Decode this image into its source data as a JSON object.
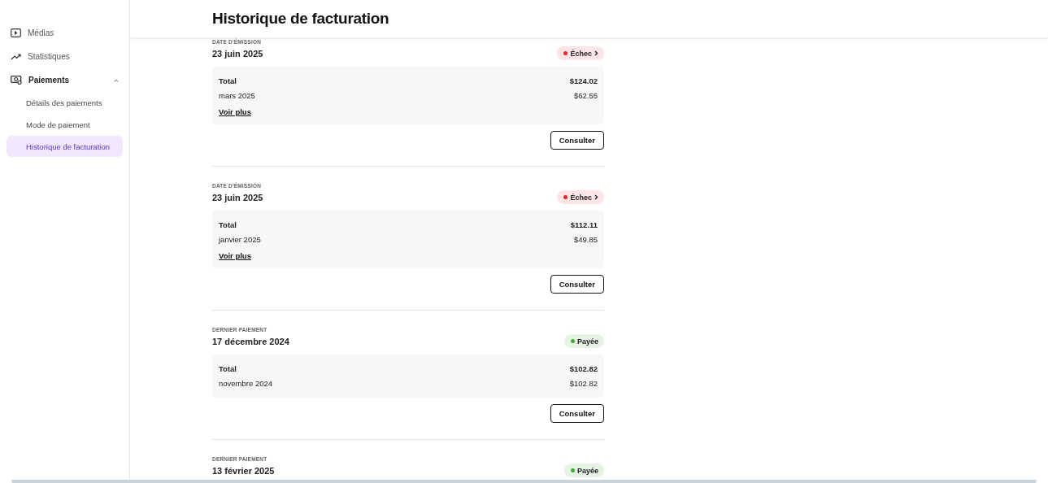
{
  "sidebar": {
    "items": [
      {
        "label": "Médias"
      },
      {
        "label": "Statistiques"
      },
      {
        "label": "Paiements",
        "expanded": true,
        "children": [
          {
            "label": "Détails des paiements",
            "selected": false
          },
          {
            "label": "Mode de paiement",
            "selected": false
          },
          {
            "label": "Historique de facturation",
            "selected": true
          }
        ]
      }
    ]
  },
  "page_title": "Historique de facturation",
  "invoices": [
    {
      "date_label": "DATE D'ÉMISSION",
      "date": "23 juin 2025",
      "status": {
        "label": "Échec",
        "kind": "failed"
      },
      "total_label": "Total",
      "total": "$124.02",
      "lines": [
        {
          "label": "mars 2025",
          "amount": "$62.55"
        }
      ],
      "more_link": "Voir plus",
      "button": "Consulter"
    },
    {
      "date_label": "DATE D'ÉMISSION",
      "date": "23 juin 2025",
      "status": {
        "label": "Échec",
        "kind": "failed"
      },
      "total_label": "Total",
      "total": "$112.11",
      "lines": [
        {
          "label": "janvier 2025",
          "amount": "$49.85"
        }
      ],
      "more_link": "Voir plus",
      "button": "Consulter"
    },
    {
      "date_label": "DERNIER PAIEMENT",
      "date": "17 décembre 2024",
      "status": {
        "label": "Payée",
        "kind": "paid"
      },
      "total_label": "Total",
      "total": "$102.82",
      "lines": [
        {
          "label": "novembre 2024",
          "amount": "$102.82"
        }
      ],
      "button": "Consulter"
    },
    {
      "date_label": "DERNIER PAIEMENT",
      "date": "13 février 2025",
      "status": {
        "label": "Payée",
        "kind": "paid"
      }
    }
  ]
}
